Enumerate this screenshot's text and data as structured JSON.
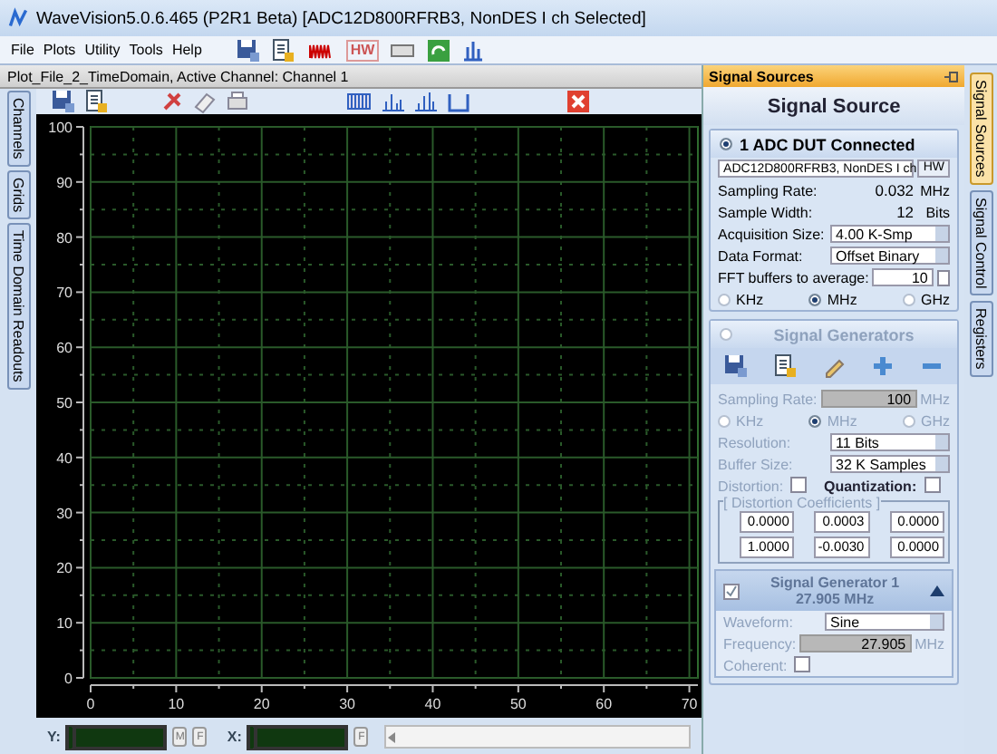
{
  "window": {
    "title": "WaveVision5.0.6.465 (P2R1 Beta)  [ADC12D800RFRB3, NonDES I ch Selected]"
  },
  "menu": [
    "File",
    "Plots",
    "Utility",
    "Tools",
    "Help"
  ],
  "main_toolbar": {
    "hw_label": "HW"
  },
  "plot_bar": {
    "title": "Plot_File_2_TimeDomain,  Active Channel: Channel 1"
  },
  "left_tabs": [
    {
      "label": "Channels",
      "selected": false
    },
    {
      "label": "Grids",
      "selected": false
    },
    {
      "label": "Time Domain Readouts",
      "selected": false
    }
  ],
  "plot": {
    "chart_data": {
      "type": "line",
      "grid": true,
      "xlim": [
        0,
        71
      ],
      "ylim": [
        0,
        100
      ],
      "xticks": [
        0,
        10,
        20,
        30,
        40,
        50,
        60,
        70
      ],
      "yticks": [
        0,
        10,
        20,
        30,
        40,
        50,
        60,
        70,
        80,
        90,
        100
      ],
      "ref_lines": [
        {
          "axis": "x",
          "value": 5
        },
        {
          "axis": "x",
          "value": 15
        },
        {
          "axis": "x",
          "value": 25
        },
        {
          "axis": "x",
          "value": 35
        },
        {
          "axis": "x",
          "value": 45
        },
        {
          "axis": "x",
          "value": 55
        },
        {
          "axis": "x",
          "value": 65
        },
        {
          "axis": "y",
          "value": 5
        },
        {
          "axis": "y",
          "value": 15
        },
        {
          "axis": "y",
          "value": 25
        },
        {
          "axis": "y",
          "value": 35
        },
        {
          "axis": "y",
          "value": 45
        },
        {
          "axis": "y",
          "value": 55
        },
        {
          "axis": "y",
          "value": 65
        },
        {
          "axis": "y",
          "value": 75
        },
        {
          "axis": "y",
          "value": 85
        },
        {
          "axis": "y",
          "value": 95
        }
      ]
    }
  },
  "readouts": {
    "y_label": "Y:",
    "y_buttons": [
      "M",
      "F"
    ],
    "x_label": "X:",
    "x_buttons": [
      "F"
    ]
  },
  "panel": {
    "title": "Signal Sources",
    "heading": "Signal Source",
    "source": {
      "title": "1 ADC DUT Connected",
      "selected": true,
      "disabled": false,
      "rows": [
        {
          "kind": "select",
          "value": "ADC12D800RFRB3, NonDES I ch",
          "button": "HW"
        },
        {
          "kind": "reading",
          "label": "Sampling Rate:",
          "value": "0.032",
          "unit": "MHz"
        },
        {
          "kind": "reading",
          "label": "Sample Width:",
          "value": "12",
          "unit": "Bits"
        },
        {
          "kind": "select",
          "label": "Acquisition Size:",
          "value": "4.00 K-Smp"
        },
        {
          "kind": "select",
          "label": "Data Format:",
          "value": "Offset Binary"
        },
        {
          "kind": "input",
          "label": "FFT buffers to average:",
          "value": "10",
          "checked": false
        },
        {
          "kind": "radios",
          "options": [
            {
              "label": "KHz",
              "selected": false
            },
            {
              "label": "MHz",
              "selected": true
            },
            {
              "label": "GHz",
              "selected": false
            }
          ]
        }
      ]
    },
    "generators": {
      "title": "Signal Generators",
      "selected": false,
      "disabled": true,
      "rows": [
        {
          "kind": "tools"
        },
        {
          "kind": "field",
          "label": "Sampling Rate:",
          "value": "100",
          "unit": "MHz"
        },
        {
          "kind": "radios",
          "options": [
            {
              "label": "KHz",
              "selected": false
            },
            {
              "label": "MHz",
              "selected": true
            },
            {
              "label": "GHz",
              "selected": false
            }
          ]
        },
        {
          "kind": "select",
          "label": "Resolution:",
          "value": "11 Bits"
        },
        {
          "kind": "select",
          "label": "Buffer Size:",
          "value": "32 K Samples"
        },
        {
          "kind": "checks",
          "items": [
            {
              "label": "Distortion:",
              "checked": false
            },
            {
              "label": "Quantization:",
              "checked": false
            }
          ]
        },
        {
          "kind": "coefficients",
          "title": "[ Distortion Coefficients ]",
          "values": [
            "0.0000",
            "0.0003",
            "0.0000",
            "1.0000",
            "-0.0030",
            "0.0000"
          ]
        }
      ],
      "generator": {
        "title": "Signal Generator 1",
        "subtitle": "27.905 MHz",
        "checked": true,
        "rows": [
          {
            "kind": "select",
            "label": "Waveform:",
            "value": "Sine"
          },
          {
            "kind": "field",
            "label": "Frequency:",
            "value": "27.905",
            "unit": "MHz"
          },
          {
            "kind": "checks",
            "items": [
              {
                "label": "Coherent:",
                "checked": false
              }
            ]
          }
        ]
      }
    }
  },
  "right_tabs": [
    {
      "label": "Signal Sources",
      "selected": true
    },
    {
      "label": "Signal Control",
      "selected": false
    },
    {
      "label": "Registers",
      "selected": false
    }
  ]
}
